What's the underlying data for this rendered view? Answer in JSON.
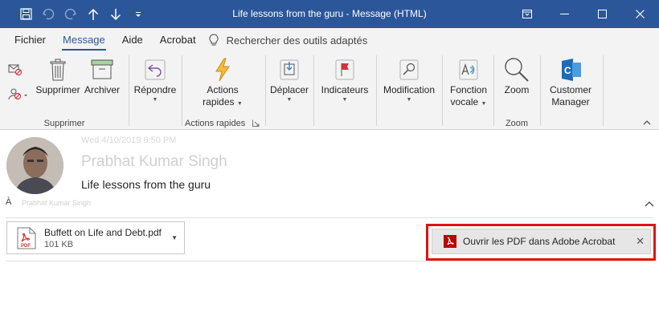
{
  "window": {
    "title": "Life lessons from the guru - Message (HTML)"
  },
  "quick_access": [
    "save-icon",
    "undo-icon",
    "redo-icon",
    "up-arrow-icon",
    "down-arrow-icon",
    "customize-icon"
  ],
  "tabs": [
    {
      "label": "Fichier"
    },
    {
      "label": "Message"
    },
    {
      "label": "Aide"
    },
    {
      "label": "Acrobat"
    }
  ],
  "tell_me": "Rechercher des outils adaptés",
  "ribbon": {
    "delete_group": {
      "label": "Supprimer",
      "delete_label": "Supprimer",
      "archive_label": "Archiver"
    },
    "respond_group": {
      "reply_label": "Répondre"
    },
    "quick_steps_group": {
      "label": "Actions rapides",
      "btn_line1": "Actions",
      "btn_line2": "rapides"
    },
    "move_group": {
      "label": "Déplacer"
    },
    "tags_group": {
      "label": "Indicateurs"
    },
    "edit_group": {
      "label": "Modification"
    },
    "speech_group": {
      "line1": "Fonction",
      "line2": "vocale"
    },
    "zoom_group": {
      "btn_label": "Zoom",
      "label": "Zoom"
    },
    "cm_group": {
      "line1": "Customer",
      "line2": "Manager"
    }
  },
  "message": {
    "date": "Wed 4/10/2019 6:50 PM",
    "sender": "Prabhat Kumar Singh",
    "subject": "Life lessons from the guru",
    "to_label": "À",
    "to_value": "Prabhat Kumar Singh"
  },
  "attachment": {
    "name": "Buffett on Life and Debt.pdf",
    "size": "101 KB",
    "icon_text": "PDF"
  },
  "acrobat_bar": {
    "text": "Ouvrir les PDF dans Adobe Acrobat",
    "close": "✕"
  },
  "colors": {
    "titlebar": "#2b579a",
    "ribbon_bg": "#f3f3f3",
    "highlight": "#e3120b",
    "pdf_red": "#d9312b"
  }
}
